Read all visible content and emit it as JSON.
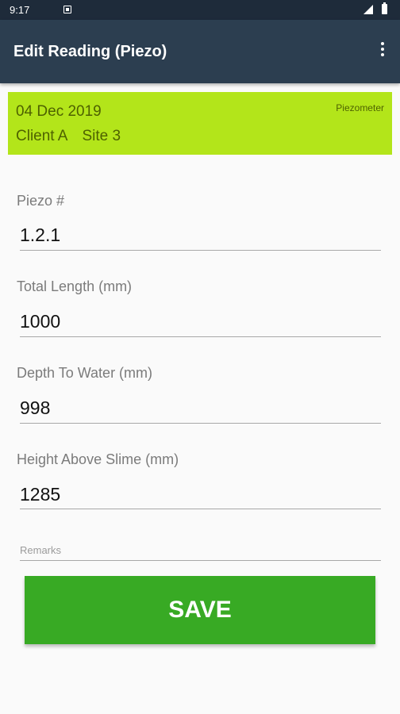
{
  "status_bar": {
    "time": "9:17"
  },
  "app_bar": {
    "title": "Edit Reading (Piezo)"
  },
  "header": {
    "date": "04 Dec 2019",
    "client": "Client A",
    "site": "Site 3",
    "type": "Piezometer"
  },
  "fields": [
    {
      "label": "Piezo #",
      "value": "1.2.1"
    },
    {
      "label": "Total Length (mm)",
      "value": "1000"
    },
    {
      "label": "Depth To Water (mm)",
      "value": "998"
    },
    {
      "label": "Height Above Slime (mm)",
      "value": "1285"
    }
  ],
  "remarks": {
    "placeholder": "Remarks"
  },
  "save_button": {
    "label": "SAVE"
  },
  "colors": {
    "status_bar": "#1e2b3a",
    "app_bar": "#2c3e50",
    "header_card": "#b3e51a",
    "save_button": "#38aa24"
  }
}
